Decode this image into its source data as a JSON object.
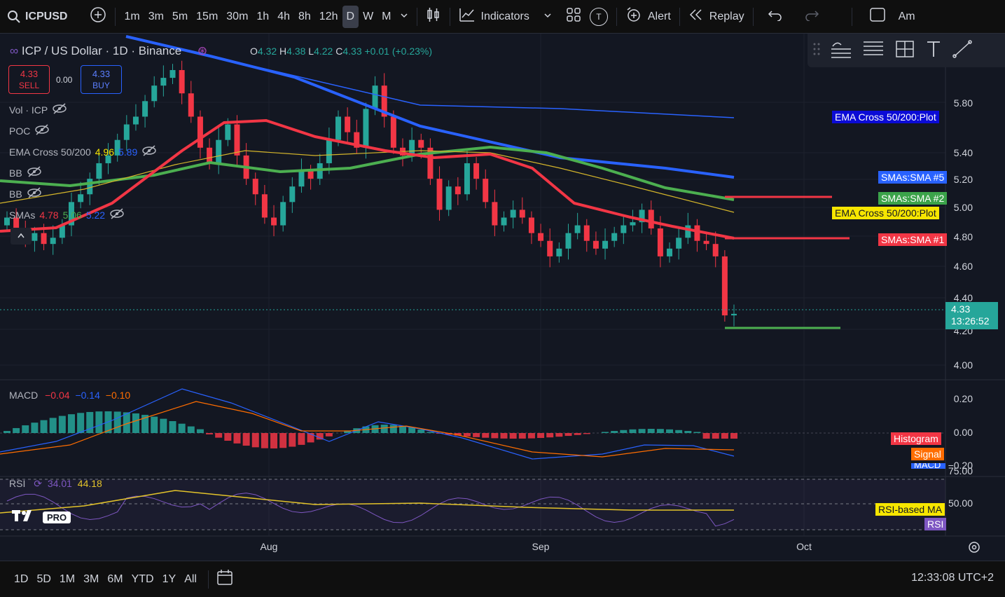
{
  "topbar": {
    "symbol": "ICPUSD",
    "intervals": [
      "1m",
      "3m",
      "5m",
      "15m",
      "30m",
      "1h",
      "4h",
      "8h",
      "12h",
      "D",
      "W",
      "M"
    ],
    "active_interval": "D",
    "indicators_label": "Indicators",
    "template_badge": "T",
    "alert_label": "Alert",
    "replay_label": "Replay",
    "trailing_label": "Am"
  },
  "legend": {
    "title": "ICP / US Dollar · 1D · Binance",
    "o_key": "O",
    "o_val": "4.32",
    "h_key": "H",
    "h_val": "4.38",
    "l_key": "L",
    "l_val": "4.22",
    "c_key": "C",
    "c_val": "4.33",
    "change": "+0.01 (+0.23%)"
  },
  "trade": {
    "sell_price": "4.33",
    "sell_label": "SELL",
    "spread": "0.00",
    "buy_price": "4.33",
    "buy_label": "BUY"
  },
  "indicators": [
    {
      "name": "Vol · ICP",
      "values": []
    },
    {
      "name": "POC",
      "values": []
    },
    {
      "name": "EMA Cross 50/200",
      "values": [
        "4.96",
        "5.89"
      ]
    },
    {
      "name": "BB",
      "values": []
    },
    {
      "name": "BB",
      "values": []
    },
    {
      "name": "SMAs",
      "values": [
        "4.78",
        "5.06",
        "5.22"
      ]
    }
  ],
  "price_axis": [
    "5.80",
    "5.40",
    "5.20",
    "5.00",
    "4.80",
    "4.60",
    "4.40",
    "4.20",
    "4.00"
  ],
  "tags": {
    "ema_plot_1": "EMA Cross 50/200:Plot",
    "sma5": "SMAs:SMA #5",
    "sma2": "SMAs:SMA #2",
    "ema_plot_2": "EMA Cross 50/200:Plot",
    "sma1": "SMAs:SMA #1",
    "last_price": "4.33",
    "countdown": "13:26:52"
  },
  "macd": {
    "label": "MACD",
    "v1": "−0.04",
    "v2": "−0.14",
    "v3": "−0.10",
    "axis": [
      "0.20",
      "0.00",
      "−0.20"
    ],
    "tag_hist": "Histogram",
    "tag_signal": "Signal",
    "tag_macd": "MACD"
  },
  "rsi": {
    "label": "RSI",
    "v1": "34.01",
    "v2": "44.18",
    "axis": [
      "75.00",
      "50.00"
    ],
    "tag_ma": "RSI-based MA",
    "tag_rsi": "RSI"
  },
  "time_axis": [
    "Aug",
    "Sep",
    "Oct"
  ],
  "logo_pro": "PRO",
  "bottombar": {
    "ranges": [
      "1D",
      "5D",
      "1M",
      "3M",
      "6M",
      "YTD",
      "1Y",
      "All"
    ],
    "clock": "12:33:08 UTC+2"
  },
  "colors": {
    "up": "#26a69a",
    "down": "#f23645",
    "ema50": "#4caf50",
    "ema200": "#2962ff",
    "sma_red": "#f23645",
    "sma_yellow": "#d4b52a",
    "macd": "#2962ff",
    "signal": "#ff6d00",
    "rsi": "#7e57c2",
    "rsi_ma": "#e3c32a"
  },
  "chart_data": {
    "type": "candlestick",
    "x_range": [
      "Jul",
      "Oct"
    ],
    "y_range": [
      4.0,
      5.9
    ],
    "candles_close_series": [
      4.95,
      4.85,
      4.8,
      4.85,
      4.78,
      4.82,
      4.9,
      5.05,
      5.1,
      5.2,
      5.3,
      5.35,
      5.45,
      5.55,
      5.6,
      5.7,
      5.8,
      5.85,
      5.9,
      5.75,
      5.6,
      5.4,
      5.3,
      5.45,
      5.55,
      5.35,
      5.2,
      5.1,
      4.95,
      4.9,
      5.05,
      5.15,
      5.25,
      5.2,
      5.3,
      5.45,
      5.6,
      5.5,
      5.4,
      5.65,
      5.8,
      5.6,
      5.4,
      5.35,
      5.45,
      5.4,
      5.2,
      5.0,
      5.15,
      5.1,
      5.3,
      5.2,
      5.05,
      4.9,
      4.95,
      5.0,
      4.95,
      4.85,
      4.8,
      4.7,
      4.75,
      4.85,
      4.9,
      4.8,
      4.75,
      4.8,
      4.85,
      4.9,
      4.92,
      5.0,
      4.88,
      4.7,
      4.75,
      4.82,
      4.9,
      4.8,
      4.78,
      4.7,
      4.32,
      4.33
    ],
    "last_close": 4.33
  }
}
